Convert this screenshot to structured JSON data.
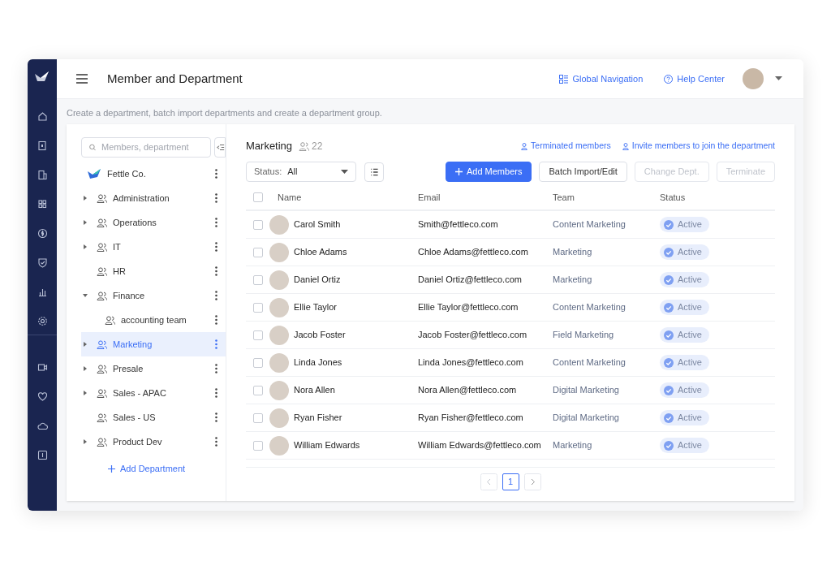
{
  "header": {
    "title": "Member and Department",
    "links": [
      "Global Navigation",
      "Help Center"
    ]
  },
  "subtitle": "Create a department, batch import departments and create a department group.",
  "tree": {
    "search": {
      "placeholder": "Members, department"
    },
    "root": "Fettle Co.",
    "items": [
      {
        "label": "Administration",
        "expanded": false,
        "selected": false
      },
      {
        "label": "Operations",
        "expanded": false,
        "selected": false
      },
      {
        "label": "IT",
        "expanded": false,
        "selected": false
      },
      {
        "label": "HR",
        "selected": false
      },
      {
        "label": "Finance",
        "expanded": true,
        "selected": false,
        "children": [
          {
            "label": "accounting team",
            "selected": false
          }
        ]
      },
      {
        "label": "Marketing",
        "expanded": false,
        "selected": true
      },
      {
        "label": "Presale",
        "expanded": false,
        "selected": false
      },
      {
        "label": "Sales - APAC",
        "expanded": false,
        "selected": false
      },
      {
        "label": "Sales - US",
        "selected": false
      },
      {
        "label": "Product Dev",
        "expanded": false,
        "selected": false
      }
    ],
    "add": "Add Department"
  },
  "department": {
    "title": "Marketing",
    "count": "22",
    "links": [
      "Terminated members",
      "Invite members to join the department"
    ]
  },
  "filter": {
    "label": "Status:",
    "value": "All"
  },
  "buttons": [
    {
      "label": "Add Members",
      "kind": "primary",
      "disabled": false
    },
    {
      "label": "Batch Import/Edit",
      "kind": "default",
      "disabled": false
    },
    {
      "label": "Change Dept.",
      "kind": "default",
      "disabled": true
    },
    {
      "label": "Terminate",
      "kind": "default",
      "disabled": true
    }
  ],
  "table": {
    "columns": [
      "Name",
      "Email",
      "Team",
      "Status"
    ],
    "all_checked": false,
    "rows": [
      {
        "checked": false,
        "name": "Carol Smith",
        "email": "Smith@fettleco.com",
        "team": "Content Marketing",
        "status": "Active"
      },
      {
        "checked": false,
        "name": "Chloe Adams",
        "email": "Chloe Adams@fettleco.com",
        "team": "Marketing",
        "status": "Active"
      },
      {
        "checked": false,
        "name": "Daniel Ortiz",
        "email": "Daniel Ortiz@fettleco.com",
        "team": "Marketing",
        "status": "Active"
      },
      {
        "checked": false,
        "name": "Ellie Taylor",
        "email": "Ellie Taylor@fettleco.com",
        "team": "Content Marketing",
        "status": "Active"
      },
      {
        "checked": false,
        "name": "Jacob Foster",
        "email": "Jacob Foster@fettleco.com",
        "team": "Field Marketing",
        "status": "Active"
      },
      {
        "checked": false,
        "name": "Linda Jones",
        "email": "Linda Jones@fettleco.com",
        "team": "Content Marketing",
        "status": "Active"
      },
      {
        "checked": false,
        "name": "Nora Allen",
        "email": "Nora Allen@fettleco.com",
        "team": "Digital Marketing",
        "status": "Active"
      },
      {
        "checked": false,
        "name": "Ryan Fisher",
        "email": "Ryan Fisher@fettleco.com",
        "team": "Digital Marketing",
        "status": "Active"
      },
      {
        "checked": false,
        "name": "William Edwards",
        "email": "William Edwards@fettleco.com",
        "team": "Marketing",
        "status": "Active"
      }
    ]
  },
  "pagination": {
    "pages": [
      {
        "label": "1",
        "selected": true
      }
    ]
  }
}
